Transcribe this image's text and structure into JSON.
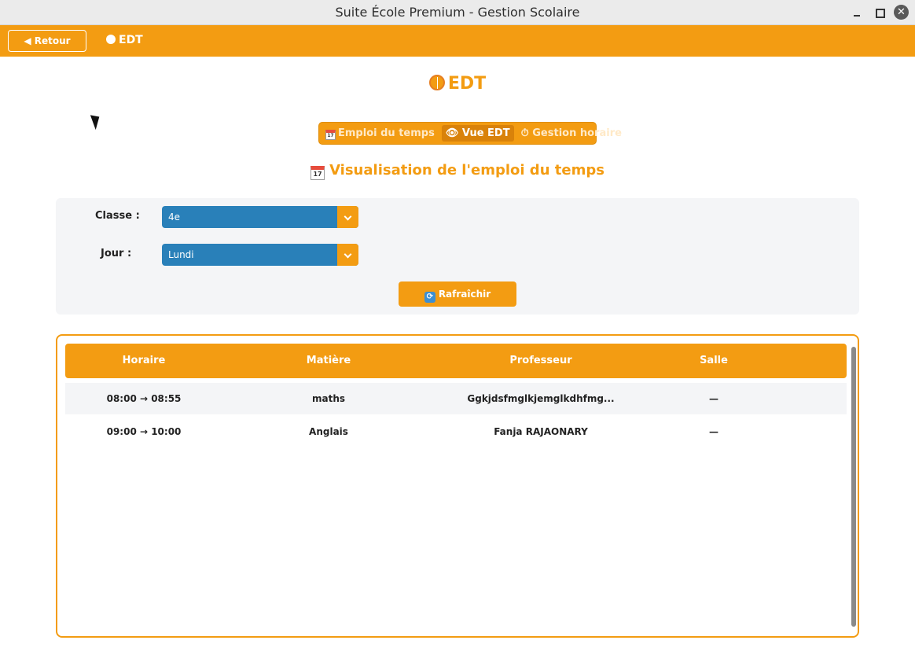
{
  "window": {
    "title": "Suite École Premium - Gestion Scolaire",
    "close_glyph": "✕"
  },
  "appbar": {
    "back_label": "◀ Retour",
    "title": "EDT"
  },
  "page": {
    "title": "EDT"
  },
  "tabs": [
    {
      "label": "Emploi du temps",
      "icon": "calendar-icon",
      "active": false
    },
    {
      "label": "Vue EDT",
      "icon": "eye-icon",
      "active": true
    },
    {
      "label": "Gestion horaire",
      "icon": "clock-icon",
      "active": false
    }
  ],
  "tab_icons": {
    "eye": "👁",
    "clock": "⏱",
    "calendar_day": "17"
  },
  "section": {
    "title": "Visualisation de l'emploi du temps",
    "calendar_day": "17"
  },
  "filters": {
    "classe_label": "Classe :",
    "classe_value": "4e",
    "jour_label": "Jour :",
    "jour_value": "Lundi",
    "refresh_label": "Rafraîchir",
    "refresh_icon": "⟳"
  },
  "table": {
    "headers": [
      "Horaire",
      "Matière",
      "Professeur",
      "Salle"
    ],
    "rows": [
      {
        "horaire": "08:00 → 08:55",
        "matiere": "maths",
        "professeur": "Ggkjdsfmglkjemglkdhfmg...",
        "salle": "—"
      },
      {
        "horaire": "09:00 → 10:00",
        "matiere": "Anglais",
        "professeur": "Fanja RAJAONARY",
        "salle": "—"
      }
    ]
  },
  "colors": {
    "accent": "#f39c12",
    "select_blue": "#2980b9",
    "panel_bg": "#f4f5f7"
  }
}
